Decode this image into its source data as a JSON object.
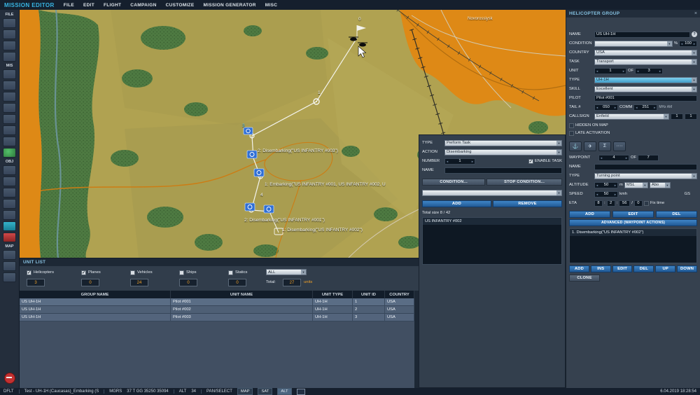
{
  "glyphs": {
    "check": "✓",
    "question": "?",
    "close": "×",
    "colon": ":",
    "slash": "/",
    "percent": "%",
    "anchor": "⚓",
    "route": "✈",
    "sigma": "Σ",
    "dots": "····"
  },
  "menubar": {
    "title": "MISSION EDITOR",
    "items": [
      "FILE",
      "EDIT",
      "FLIGHT",
      "CAMPAIGN",
      "CUSTOMIZE",
      "MISSION GENERATOR",
      "MISC"
    ]
  },
  "left_toolbar": {
    "labels": [
      "FILE",
      "MIS",
      "OBJ",
      "MAP"
    ]
  },
  "map": {
    "labels": [
      {
        "text": "0"
      },
      {
        "text": "1"
      },
      {
        "text": "3"
      },
      {
        "text": "4"
      },
      {
        "text": "2: Disembarking(\"US INFANTRY #003\")"
      },
      {
        "text": "1: Embarking(\"US INFANTRY #001, US INFANTRY #002, U"
      },
      {
        "text": "2: Disembarking(\"US INFANTRY #001\")"
      },
      {
        "text": "1: Disembarking(\"US INFANTRY #002\")"
      },
      {
        "text": "Novorossiysk"
      }
    ]
  },
  "helicopter_group": {
    "title": "HELICOPTER GROUP",
    "name_label": "NAME",
    "name_value": "US UH-1H",
    "condition_label": "CONDITION",
    "condition_value": "100",
    "country_label": "COUNTRY",
    "country_value": "USA",
    "task_label": "TASK",
    "task_value": "Transport",
    "unit_label": "UNIT",
    "unit_value": "1",
    "unit_of": "OF",
    "unit_count": "3",
    "type_label": "TYPE",
    "type_value": "UH-1H",
    "skill_label": "SKILL",
    "skill_value": "Excellent",
    "pilot_label": "PILOT",
    "pilot_value": "Pilot #001",
    "tail_label": "TAIL #",
    "tail_value": "050",
    "comm_label": "COMM",
    "comm_value": "251",
    "comm_unit": "MHz AM",
    "callsign_label": "CALLSIGN",
    "callsign_value": "Enfield",
    "callsign_flight": "1",
    "callsign_number": "1",
    "hidden_label": "HIDDEN ON MAP",
    "late_label": "LATE ACTIVATION"
  },
  "waypoint_panel": {
    "label": "WAYPOINT",
    "index": "4",
    "of": "OF",
    "count": "7",
    "name_label": "NAME",
    "name_value": "",
    "type_label": "TYPE",
    "type_value": "Turning point",
    "altitude_label": "ALTITUDE",
    "altitude_value": "50",
    "altitude_unit": "m",
    "altitude_msl": "MSL",
    "altitude_mode": "Abo",
    "speed_label": "SPEED",
    "speed_value": "50",
    "speed_unit": "kmh",
    "gs_label": "GS",
    "eta_label": "ETA",
    "eta_h": "8",
    "eta_m": "2",
    "eta_s": "56",
    "eta_day": "0",
    "fix_time": "Fix time",
    "add": "ADD",
    "edit": "EDIT",
    "del": "DEL",
    "advanced": "ADVANCED (WAYPOINT ACTIONS)",
    "action_item": "1. Disembarking(\"US INFANTRY #002\")",
    "add2": "ADD",
    "ins": "INS",
    "edit2": "EDIT",
    "del2": "DEL",
    "up": "UP",
    "down": "DOWN",
    "clone": "CLONE"
  },
  "task_dialog": {
    "type_label": "TYPE",
    "type_value": "Perform Task",
    "action_label": "ACTION",
    "action_value": "Disembarking",
    "number_label": "NUMBER",
    "number_value": "1",
    "enable_task": "ENABLE TASK",
    "name_label": "NAME",
    "name_value": "",
    "condition": "CONDITION...",
    "stop_condition": "STOP CONDITION...",
    "add": "ADD",
    "remove": "REMOVE",
    "total": "Total size 8 / 42",
    "item": "US INFANTRY #002"
  },
  "unit_list": {
    "title": "UNIT LIST",
    "filters": [
      {
        "label": "Helicopters",
        "check": "✓",
        "count": "3"
      },
      {
        "label": "Planes",
        "check": "✓",
        "count": "0"
      },
      {
        "label": "Vehicles",
        "check": "",
        "count": "24"
      },
      {
        "label": "Ships",
        "check": "",
        "count": "0"
      },
      {
        "label": "Statics",
        "check": "",
        "count": "0"
      }
    ],
    "all": "ALL",
    "total_label": "Total:",
    "total_value": "27",
    "units": "units",
    "columns": [
      "GROUP NAME",
      "UNIT NAME",
      "UNIT TYPE",
      "UNIT ID",
      "COUNTRY"
    ],
    "rows": [
      {
        "group": "US UH-1H",
        "unit": "Pilot #001",
        "type": "UH-1H",
        "id": "1",
        "country": "USA"
      },
      {
        "group": "US UH-1H",
        "unit": "Pilot #002",
        "type": "UH-1H",
        "id": "2",
        "country": "USA"
      },
      {
        "group": "US UH-1H",
        "unit": "Pilot #003",
        "type": "UH-1H",
        "id": "3",
        "country": "USA"
      }
    ]
  },
  "statusbar": {
    "mode": "DFLT",
    "filename": "Test - UH-1H (Caucasas)_Embarking (S",
    "mgrs": "MGRS",
    "coords": "37 T GG 35250 35094",
    "alt_label": "ALT",
    "alt_value": "34",
    "pan": "PAN/SELECT",
    "map": "MAP",
    "sat": "SAT",
    "alt": "ALT",
    "datetime": "6.04.2019 18:28:54"
  }
}
